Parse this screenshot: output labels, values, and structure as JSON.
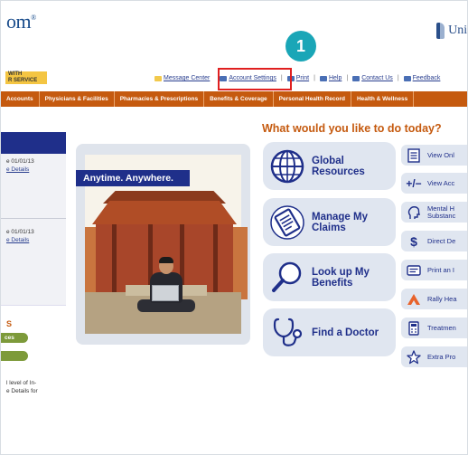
{
  "header": {
    "logo_text": "om",
    "logo_mark": "®",
    "brand_text": "Unit",
    "with_badge": [
      "WITH",
      "R SERVICE"
    ],
    "step_number": "1",
    "links": {
      "message_center": "Message Center",
      "account_settings": "Account Settings",
      "print": "Print",
      "help": "Help",
      "contact_us": "Contact Us",
      "feedback": "Feedback",
      "separator": "|"
    }
  },
  "nav": {
    "items": [
      "Accounts",
      "Physicians & Facilities",
      "Pharmacies & Prescriptions",
      "Benefits & Coverage",
      "Personal Health Record",
      "Health & Wellness"
    ]
  },
  "left": {
    "entry1": {
      "date": "e 01/01/13",
      "link": "e Details"
    },
    "entry2": {
      "date": "e 01/01/13",
      "link": "e Details"
    },
    "section_mark": "S",
    "pill_label": "ces",
    "lower_text": "l level of In-\ne Details for"
  },
  "hero": {
    "banner": "Anytime. Anywhere."
  },
  "main": {
    "question": "What would you like to do today?",
    "tiles": [
      {
        "label": "Global\nResources",
        "icon": "globe-icon"
      },
      {
        "label": "Manage My\nClaims",
        "icon": "claims-document-icon"
      },
      {
        "label": "Look up My\nBenefits",
        "icon": "magnifier-icon"
      },
      {
        "label": "Find a Doctor",
        "icon": "stethoscope-icon"
      }
    ]
  },
  "side": {
    "items": [
      {
        "label": "View Onl",
        "icon": "list-document-icon"
      },
      {
        "label": "View Acc",
        "icon": "plus-minus-icon"
      },
      {
        "label": "Mental H\nSubstanc",
        "icon": "head-icon"
      },
      {
        "label": "Direct De",
        "icon": "dollar-icon"
      },
      {
        "label": "Print an I",
        "icon": "id-card-icon"
      },
      {
        "label": "Rally Hea",
        "icon": "rally-logo-icon"
      },
      {
        "label": "Treatmen",
        "icon": "calculator-icon"
      },
      {
        "label": "Extra Pro",
        "icon": "star-icon"
      }
    ]
  },
  "colors": {
    "nav_orange": "#c55a0f",
    "navy": "#1f2f8a",
    "tile_bg": "#e0e6f0",
    "highlight_red": "#e02020",
    "badge_teal": "#1aa6b7"
  }
}
